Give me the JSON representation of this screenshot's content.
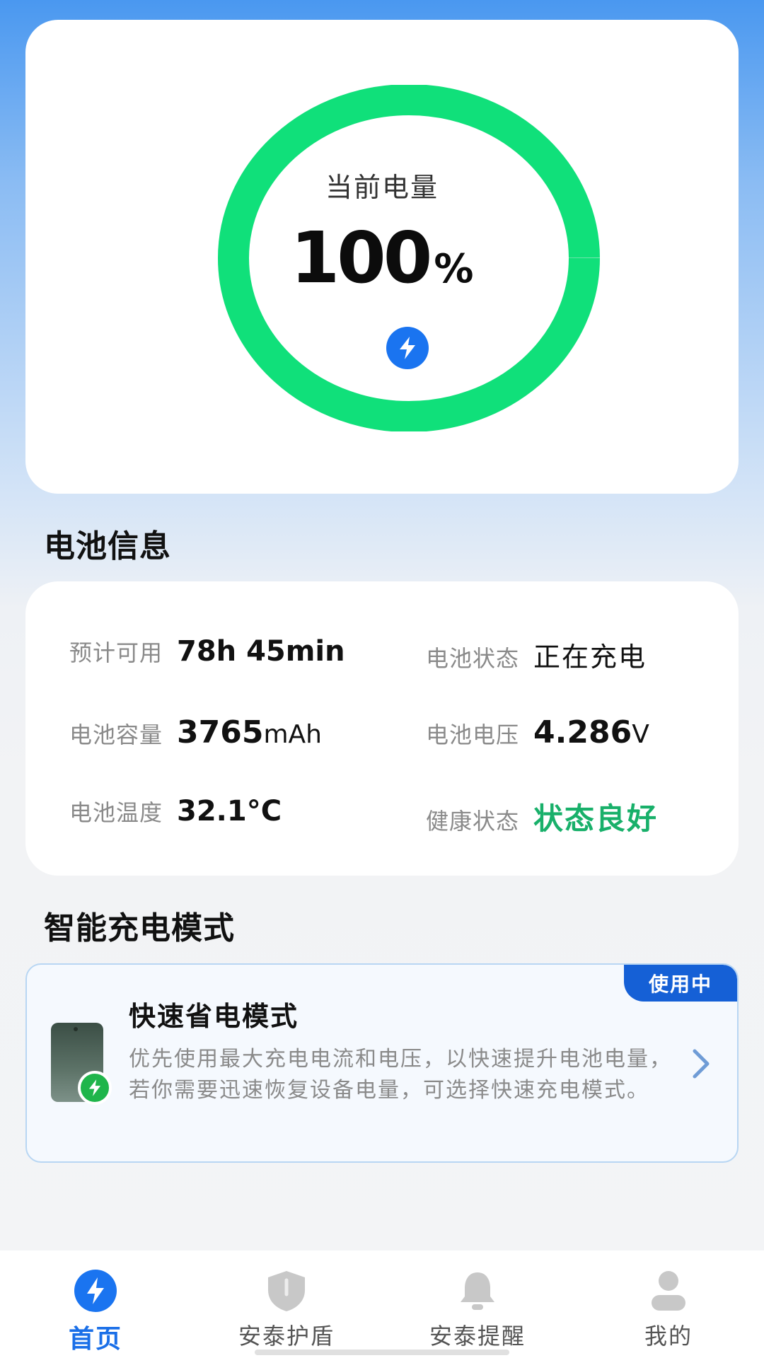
{
  "battery": {
    "ring_label": "当前电量",
    "level_number": "100",
    "level_unit": "%",
    "level_fraction": 1.0,
    "ring_color": "#10e07a",
    "charging_icon": "lightning-bolt-icon"
  },
  "battery_info": {
    "title": "电池信息",
    "items": [
      {
        "label": "预计可用",
        "value": "78h 45min",
        "unit": ""
      },
      {
        "label": "电池状态",
        "value": "正在充电",
        "unit": ""
      },
      {
        "label": "电池容量",
        "value": "3765",
        "unit": "mAh"
      },
      {
        "label": "电池电压",
        "value": "4.286",
        "unit": "V"
      },
      {
        "label": "电池温度",
        "value": "32.1°C",
        "unit": ""
      },
      {
        "label": "健康状态",
        "value": "状态良好",
        "unit": ""
      }
    ]
  },
  "smart_mode": {
    "title": "智能充电模式",
    "card": {
      "badge": "使用中",
      "name": "快速省电模式",
      "description": "优先使用最大充电电流和电压，以快速提升电池电量，若你需要迅速恢复设备电量，可选择快速充电模式。"
    }
  },
  "nav": {
    "items": [
      {
        "label": "首页",
        "icon": "bolt-circle-icon",
        "active": true
      },
      {
        "label": "安泰护盾",
        "icon": "shield-icon",
        "active": false
      },
      {
        "label": "安泰提醒",
        "icon": "bell-icon",
        "active": false
      },
      {
        "label": "我的",
        "icon": "user-icon",
        "active": false
      }
    ]
  },
  "colors": {
    "accent": "#1a6fe8",
    "good": "#18b06a",
    "badge": "#1560d6"
  }
}
